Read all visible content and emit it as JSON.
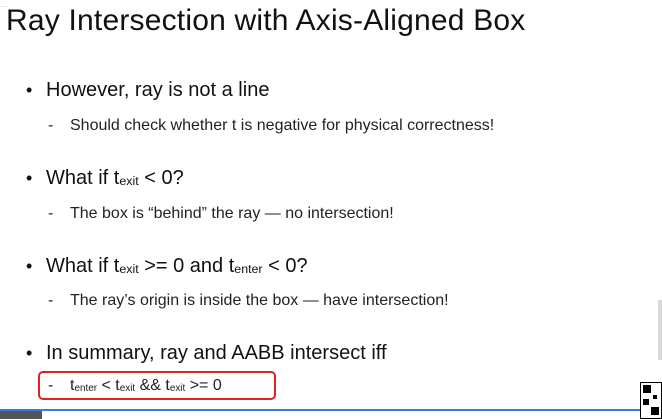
{
  "title": "Ray Intersection with Axis-Aligned Box",
  "watermark": "…",
  "bullets": [
    {
      "text": "However, ray is not a line",
      "sub": "Should check whether t is negative for physical correctness!"
    },
    {
      "pre": "What if t",
      "sub1": "exit",
      "post": " < 0?",
      "sub": "The box is “behind” the ray — no intersection!"
    },
    {
      "pre": "What if t",
      "sub1": "exit",
      "mid": " >= 0 and t",
      "sub2": "enter",
      "post": " < 0?",
      "sub": "The ray’s origin is inside the box — have intersection!"
    },
    {
      "text": "In summary, ray and AABB intersect iff"
    }
  ],
  "formula": {
    "t1": "t",
    "s1": "enter",
    "op1": " < t",
    "s2": "exit",
    "op2": " && t",
    "s3": "exit",
    "op3": " >= 0"
  },
  "dash": "-",
  "dot": "•",
  "colors": {
    "highlight": "#e22020",
    "rule": "#3a7bd5"
  }
}
